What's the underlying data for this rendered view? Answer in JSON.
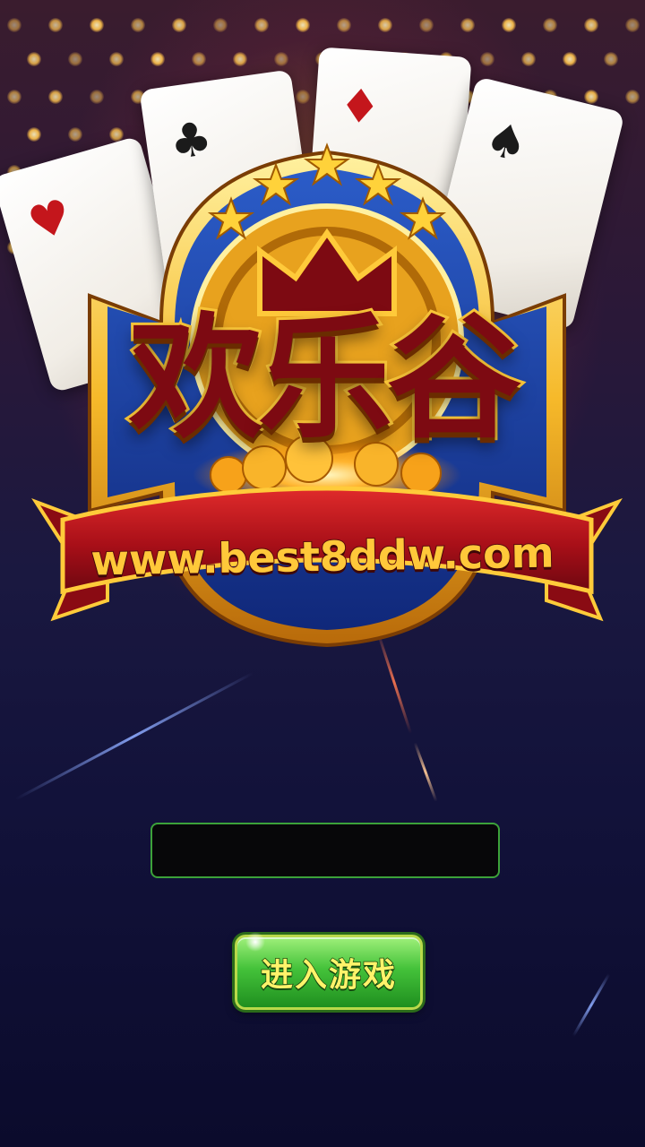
{
  "app": {
    "logo_text": [
      "欢",
      "乐",
      "谷"
    ],
    "website": "www.best8ddw.com"
  },
  "login": {
    "name_input_value": "",
    "name_input_placeholder": "",
    "enter_button_label": "进入游戏"
  },
  "decor": {
    "cards": [
      {
        "suit": "♥",
        "color": "red"
      },
      {
        "suit": "♣",
        "color": "black"
      },
      {
        "suit": "♦",
        "color": "red"
      },
      {
        "suit": "♠",
        "color": "black"
      }
    ],
    "stars": 5,
    "colors": {
      "logo_fill": "#7d0a12",
      "logo_outline": "#ffca3a",
      "emblem_blue": "#1c3f9e",
      "ribbon_red": "#b3121b",
      "button_green": "#44c23a",
      "input_border": "#3ca23a"
    }
  }
}
